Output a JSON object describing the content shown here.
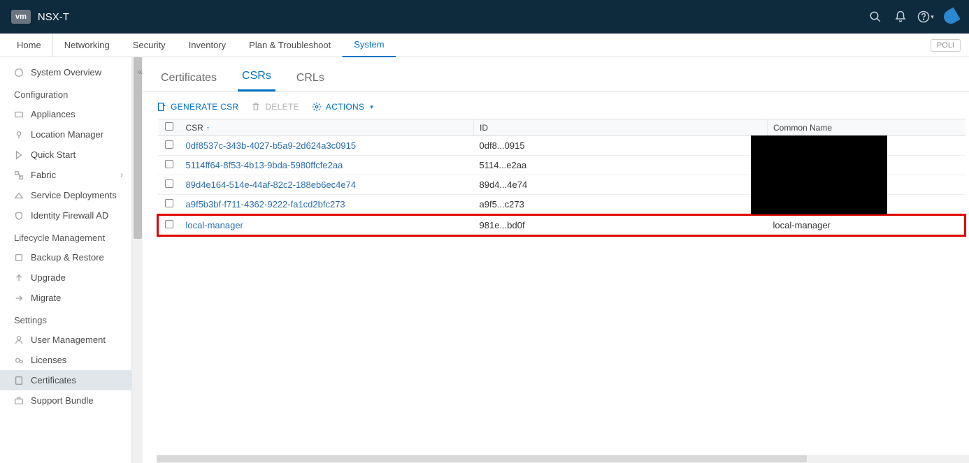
{
  "header": {
    "logo": "vm",
    "title": "NSX-T"
  },
  "nav": {
    "tabs": [
      "Home",
      "Networking",
      "Security",
      "Inventory",
      "Plan & Troubleshoot",
      "System"
    ],
    "active": "System",
    "mode_pill": "POLI"
  },
  "sidebar": {
    "top": {
      "label": "System Overview"
    },
    "sections": [
      {
        "title": "Configuration",
        "items": [
          {
            "label": "Appliances"
          },
          {
            "label": "Location Manager"
          },
          {
            "label": "Quick Start"
          },
          {
            "label": "Fabric",
            "expandable": true
          },
          {
            "label": "Service Deployments"
          },
          {
            "label": "Identity Firewall AD"
          }
        ]
      },
      {
        "title": "Lifecycle Management",
        "items": [
          {
            "label": "Backup & Restore"
          },
          {
            "label": "Upgrade"
          },
          {
            "label": "Migrate"
          }
        ]
      },
      {
        "title": "Settings",
        "items": [
          {
            "label": "User Management"
          },
          {
            "label": "Licenses"
          },
          {
            "label": "Certificates",
            "selected": true
          },
          {
            "label": "Support Bundle"
          }
        ]
      }
    ]
  },
  "subtabs": {
    "items": [
      "Certificates",
      "CSRs",
      "CRLs"
    ],
    "active": "CSRs"
  },
  "actions": {
    "generate": "GENERATE CSR",
    "delete": "DELETE",
    "actions": "ACTIONS"
  },
  "table": {
    "columns": {
      "csr": "CSR",
      "id": "ID",
      "cn": "Common Name"
    },
    "rows": [
      {
        "csr": "0df8537c-343b-4027-b5a9-2d624a3c0915",
        "id": "0df8...0915",
        "cn": ""
      },
      {
        "csr": "5114ff64-8f53-4b13-9bda-5980ffcfe2aa",
        "id": "5114...e2aa",
        "cn": ""
      },
      {
        "csr": "89d4e164-514e-44af-82c2-188eb6ec4e74",
        "id": "89d4...4e74",
        "cn": ""
      },
      {
        "csr": "a9f5b3bf-f711-4362-9222-fa1cd2bfc273",
        "id": "a9f5...c273",
        "cn": ""
      },
      {
        "csr": "local-manager",
        "id": "981e...bd0f",
        "cn": "local-manager",
        "highlighted": true
      }
    ]
  }
}
